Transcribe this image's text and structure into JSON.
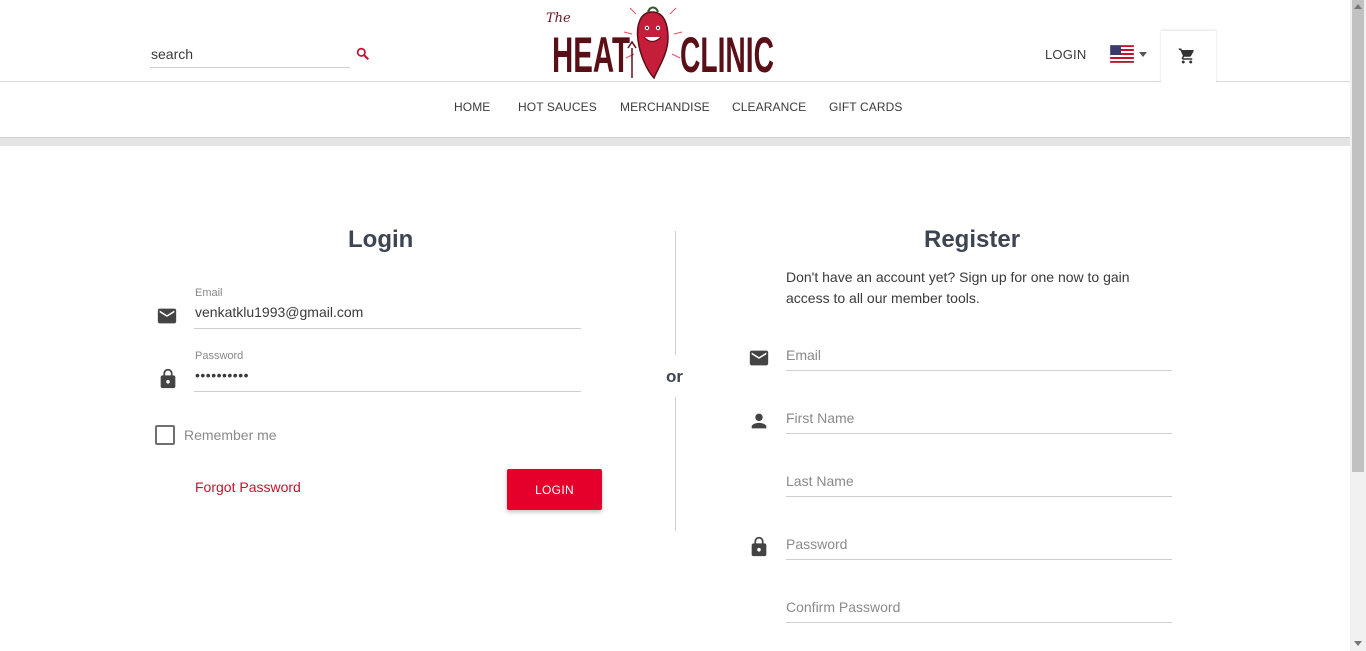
{
  "header": {
    "search_placeholder": "search",
    "logo_text": "The HEAT CLINIC",
    "login_label": "LOGIN",
    "flag_icon": "us-flag-icon",
    "cart_icon": "shopping-cart-icon"
  },
  "nav": {
    "items": [
      {
        "label": "HOME"
      },
      {
        "label": "HOT SAUCES"
      },
      {
        "label": "MERCHANDISE"
      },
      {
        "label": "CLEARANCE"
      },
      {
        "label": "GIFT CARDS"
      }
    ]
  },
  "login": {
    "title": "Login",
    "email_label": "Email",
    "email_value": "venkatklu1993@gmail.com",
    "password_label": "Password",
    "password_value": "••••••••••",
    "remember_label": "Remember me",
    "forgot_label": "Forgot Password",
    "button_label": "LOGIN"
  },
  "divider_text": "or",
  "register": {
    "title": "Register",
    "description": "Don't have an account yet? Sign up for one now to gain access to all our member tools.",
    "email_placeholder": "Email",
    "first_name_placeholder": "First Name",
    "last_name_placeholder": "Last Name",
    "password_placeholder": "Password",
    "confirm_password_placeholder": "Confirm Password"
  },
  "colors": {
    "accent": "#e4002b",
    "link": "#c8102e",
    "heading": "#3d4553"
  }
}
